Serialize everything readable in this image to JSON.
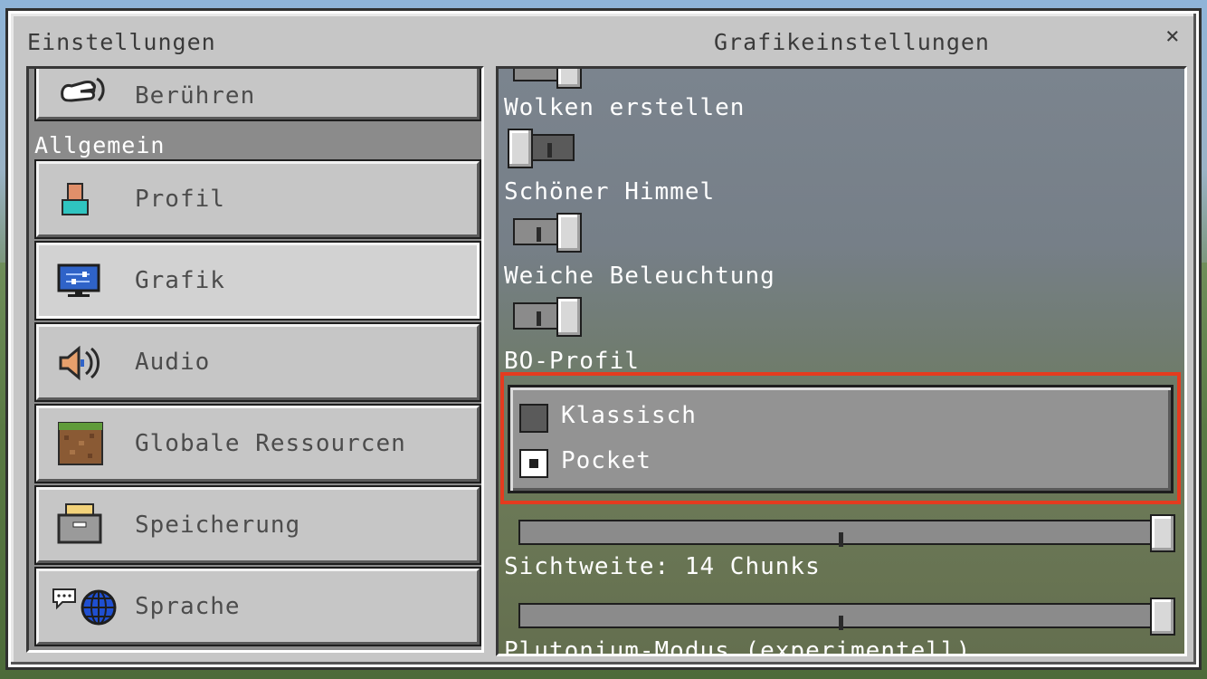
{
  "window": {
    "left_title": "Einstellungen",
    "right_title": "Grafikeinstellungen",
    "close_glyph": "×"
  },
  "sidebar": {
    "items_top": [
      {
        "label": "Berühren",
        "icon": "touch-hand-icon"
      }
    ],
    "section_label": "Allgemein",
    "items": [
      {
        "label": "Profil",
        "icon": "profile-icon"
      },
      {
        "label": "Grafik",
        "icon": "monitor-icon",
        "selected": true
      },
      {
        "label": "Audio",
        "icon": "speaker-icon"
      },
      {
        "label": "Globale Ressourcen",
        "icon": "dirt-block-icon"
      },
      {
        "label": "Speicherung",
        "icon": "storage-folder-icon"
      },
      {
        "label": "Sprache",
        "icon": "language-globe-icon"
      }
    ]
  },
  "graphics": {
    "clouds": {
      "label": "Wolken erstellen",
      "on": false
    },
    "fancy_sky": {
      "label": "Schöner Himmel",
      "on": true
    },
    "smooth_lighting": {
      "label": "Weiche Beleuchtung",
      "on": true
    },
    "ui_profile": {
      "label": "BO-Profil",
      "options": [
        {
          "label": "Klassisch",
          "selected": false
        },
        {
          "label": "Pocket",
          "selected": true
        }
      ]
    },
    "render_distance": {
      "label": "Sichtweite: 14 Chunks",
      "value_fraction": 1.0
    },
    "upper_slider_value_fraction": 1.0,
    "bottom_cut_label": "Plutonium-Modus (experimentell)"
  },
  "colors": {
    "highlight": "#e43b1f",
    "panel_bg": "#c6c6c6"
  }
}
